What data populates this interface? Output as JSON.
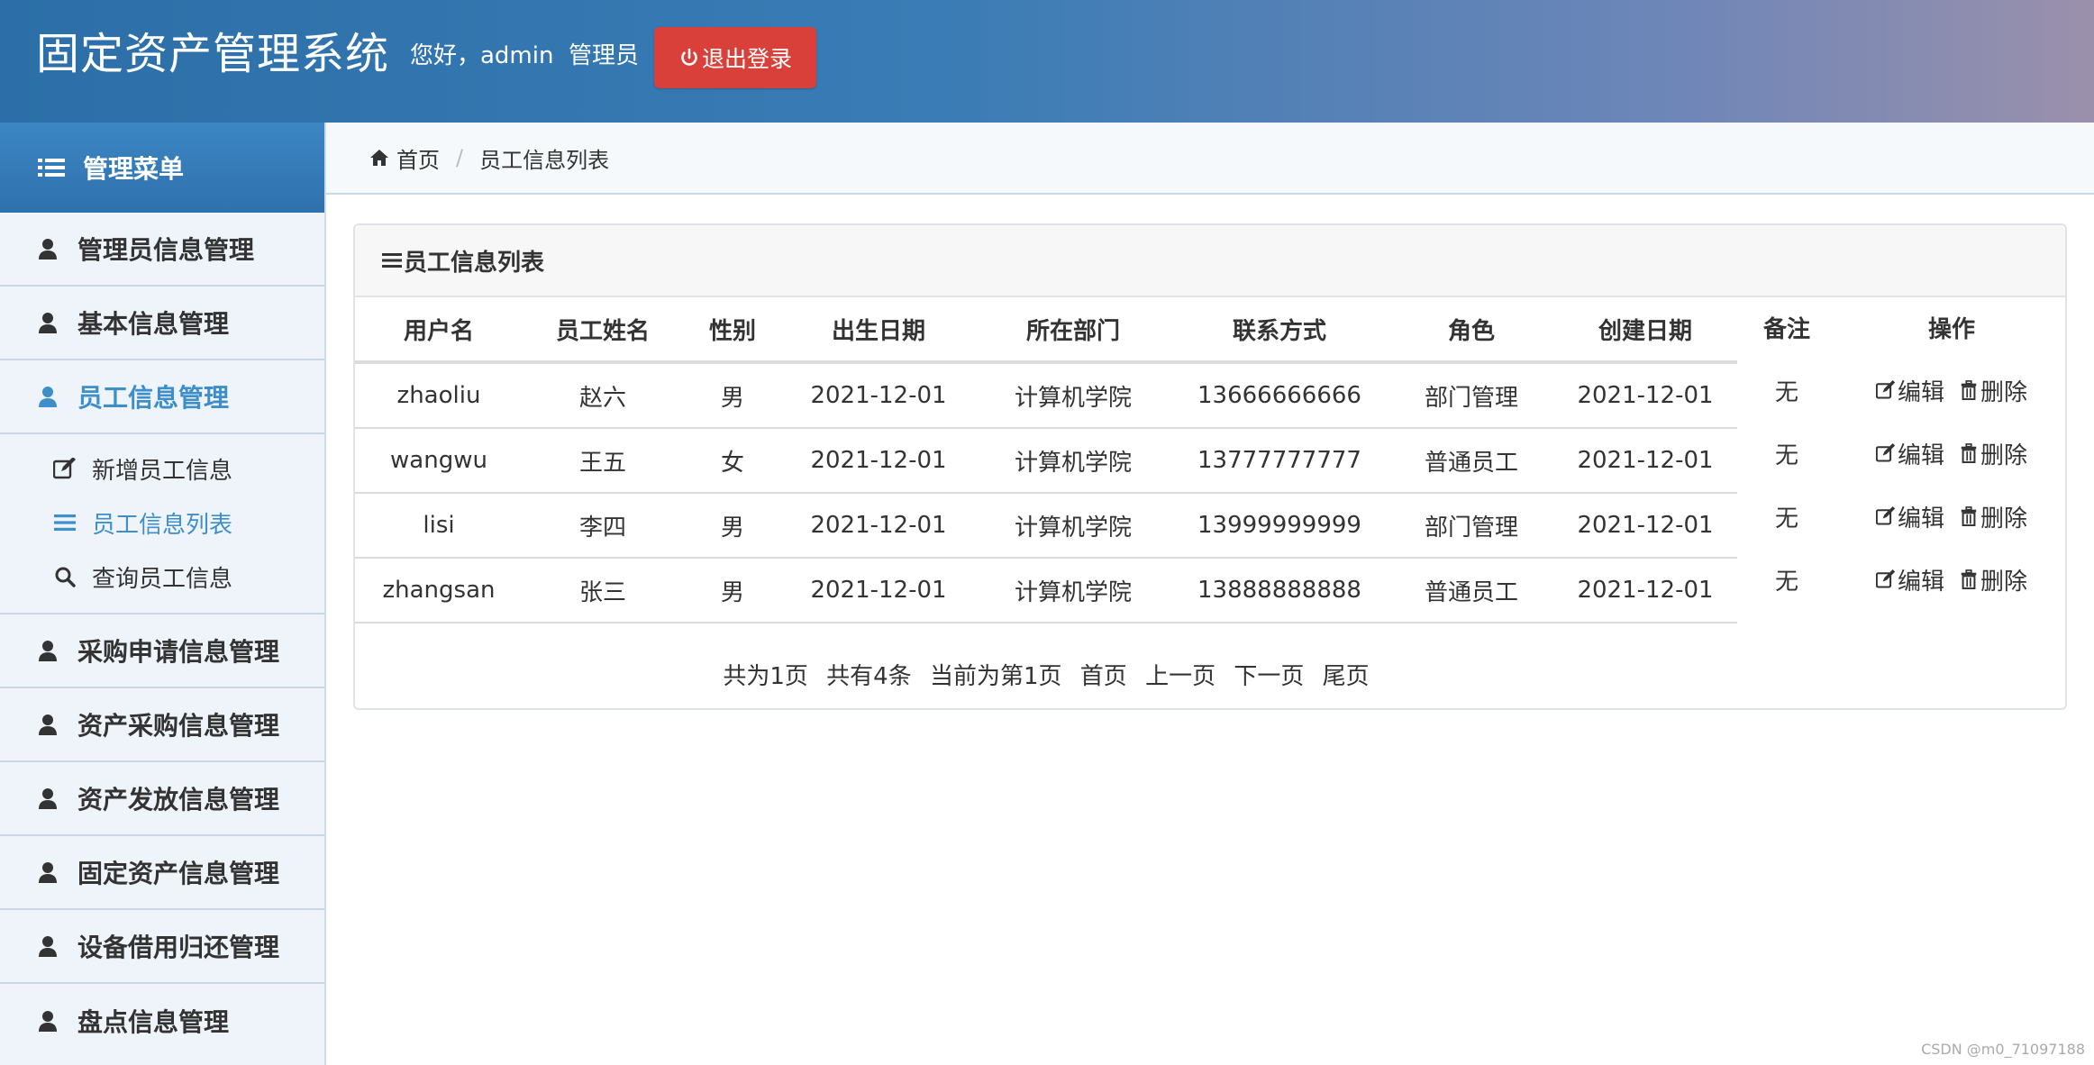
{
  "header": {
    "app_title": "固定资产管理系统",
    "greeting": "您好，admin  管理员",
    "logout_label": "退出登录"
  },
  "sidebar": {
    "menu_title": "管理菜单",
    "items": [
      {
        "label": "管理员信息管理"
      },
      {
        "label": "基本信息管理"
      },
      {
        "label": "员工信息管理"
      }
    ],
    "subitems": [
      {
        "label": "新增员工信息"
      },
      {
        "label": "员工信息列表"
      },
      {
        "label": "查询员工信息"
      }
    ],
    "items_after": [
      {
        "label": "采购申请信息管理"
      },
      {
        "label": "资产采购信息管理"
      },
      {
        "label": "资产发放信息管理"
      },
      {
        "label": "固定资产信息管理"
      },
      {
        "label": "设备借用归还管理"
      },
      {
        "label": "盘点信息管理"
      }
    ]
  },
  "breadcrumb": {
    "home": "首页",
    "current": "员工信息列表"
  },
  "panel": {
    "title": "员工信息列表"
  },
  "table": {
    "headers": [
      "用户名",
      "员工姓名",
      "性别",
      "出生日期",
      "所在部门",
      "联系方式",
      "角色",
      "创建日期",
      "备注",
      "操作"
    ],
    "rows": [
      [
        "zhaoliu",
        "赵六",
        "男",
        "2021-12-01",
        "计算机学院",
        "13666666666",
        "部门管理",
        "2021-12-01",
        "无"
      ],
      [
        "wangwu",
        "王五",
        "女",
        "2021-12-01",
        "计算机学院",
        "13777777777",
        "普通员工",
        "2021-12-01",
        "无"
      ],
      [
        "lisi",
        "李四",
        "男",
        "2021-12-01",
        "计算机学院",
        "13999999999",
        "部门管理",
        "2021-12-01",
        "无"
      ],
      [
        "zhangsan",
        "张三",
        "男",
        "2021-12-01",
        "计算机学院",
        "13888888888",
        "普通员工",
        "2021-12-01",
        "无"
      ]
    ],
    "edit_label": "编辑",
    "delete_label": "删除"
  },
  "pager": {
    "total_pages": "共为1页",
    "total_items": "共有4条",
    "current": "当前为第1页",
    "first": "首页",
    "prev": "上一页",
    "next": "下一页",
    "last": "尾页"
  },
  "watermark": "CSDN @m0_71097188"
}
